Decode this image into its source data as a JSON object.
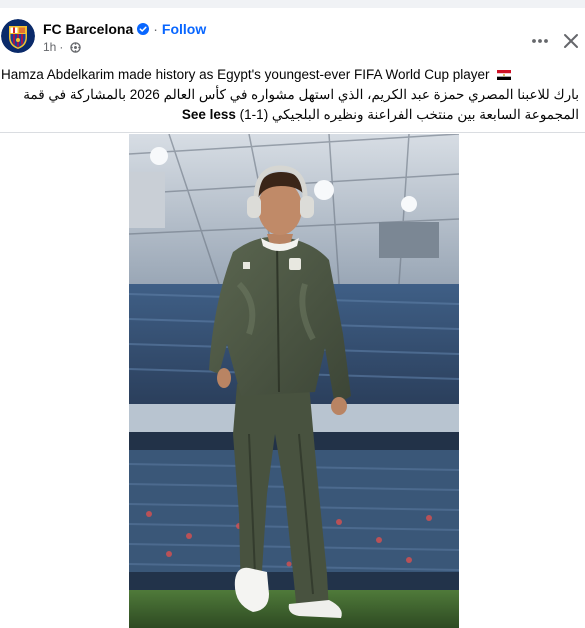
{
  "post": {
    "author": "FC Barcelona",
    "follow_label": "Follow",
    "time": "1h",
    "caption_en": "Hamza Abdelkarim made history as Egypt's youngest-ever FIFA World Cup player",
    "caption_ar_line1": "بارك للاعبنا المصري حمزة عبد الكريم، الذي استهل مشواره في كأس العالم 2026 بالمشاركة في قمة",
    "caption_ar_line2": "المجموعة السابعة بين منتخب الفراعنة ونظيره البلجيكي (1-1)",
    "see_less_label": "See less"
  },
  "icons": {
    "avatar": "fc-barcelona-crest",
    "verified": "verified-badge-icon",
    "privacy": "globe-icon",
    "more": "more-options-icon",
    "close": "close-icon",
    "flag": "egypt-flag-icon"
  },
  "colors": {
    "accent": "#0866ff",
    "secondary_text": "#65676b",
    "background": "#f0f2f5"
  }
}
